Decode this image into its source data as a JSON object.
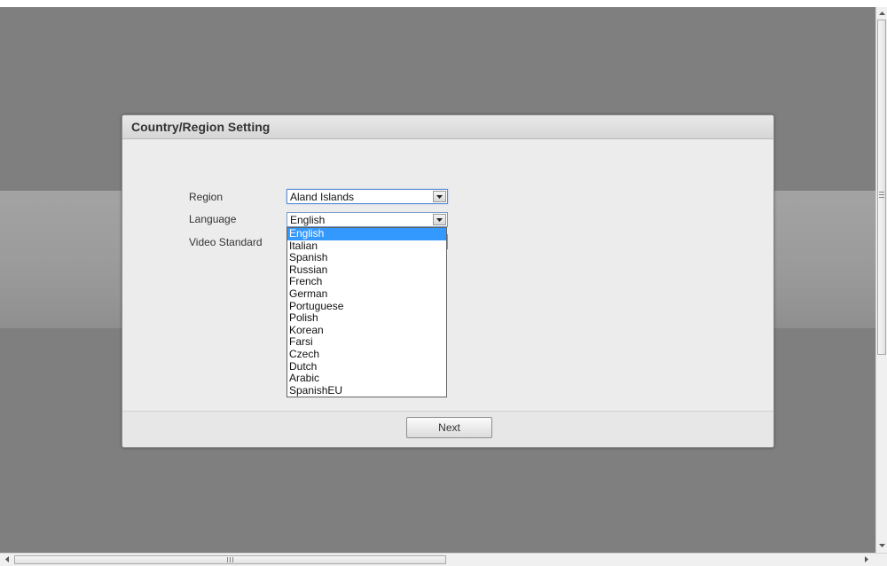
{
  "dialog": {
    "title": "Country/Region Setting",
    "fields": {
      "region": {
        "label": "Region",
        "value": "Aland Islands"
      },
      "language": {
        "label": "Language",
        "value": "English"
      },
      "video_standard": {
        "label": "Video Standard"
      }
    },
    "language_options": [
      "English",
      "Italian",
      "Spanish",
      "Russian",
      "French",
      "German",
      "Portuguese",
      "Polish",
      "Korean",
      "Farsi",
      "Czech",
      "Dutch",
      "Arabic",
      "SpanishEU"
    ],
    "selected_language_index": 0,
    "next_label": "Next"
  },
  "icons": {
    "dropdown": "chevron-down-icon",
    "scroll_up": "arrow-up-icon",
    "scroll_down": "arrow-down-icon",
    "scroll_left": "arrow-left-icon",
    "scroll_right": "arrow-right-icon"
  },
  "colors": {
    "backdrop": "#7f7f7f",
    "dialog": "#ececec",
    "selection": "#3399ff"
  }
}
